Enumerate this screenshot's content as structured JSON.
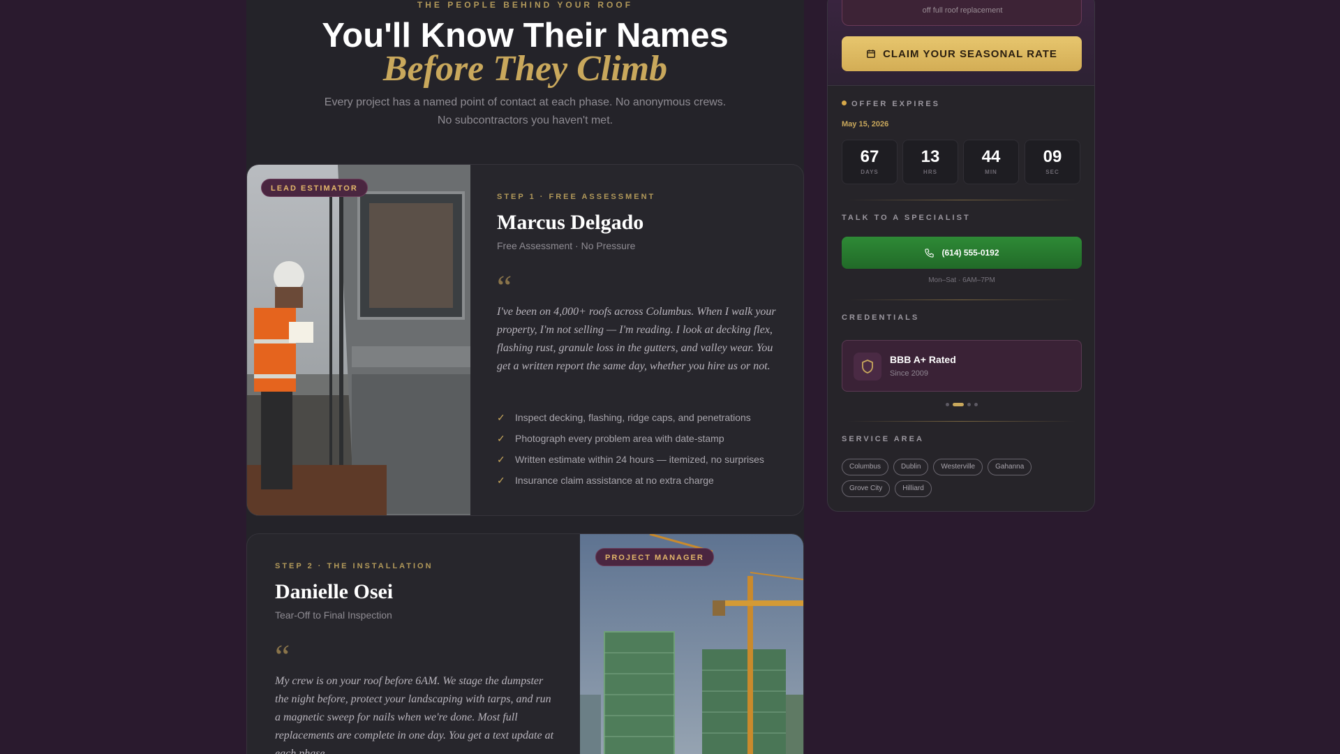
{
  "section": {
    "eyebrow": "THE PEOPLE BEHIND YOUR ROOF",
    "title": "You'll Know Their Names",
    "title_accent": "Before They Climb",
    "intro": "Every project has a named point of contact at each phase. No anonymous crews. No subcontractors you haven't met."
  },
  "team": [
    {
      "badge": "LEAD ESTIMATOR",
      "step": "STEP 1 · FREE ASSESSMENT",
      "name": "Marcus Delgado",
      "subtitle": "Free Assessment · No Pressure",
      "quote": "I've been on 4,000+ roofs across Columbus. When I walk your property, I'm not selling — I'm reading. I look at decking flex, flashing rust, granule loss in the gutters, and valley wear. You get a written report the same day, whether you hire us or not.",
      "checklist": [
        "Inspect decking, flashing, ridge caps, and penetrations",
        "Photograph every problem area with date-stamp",
        "Written estimate within 24 hours — itemized, no surprises",
        "Insurance claim assistance at no extra charge"
      ]
    },
    {
      "badge": "PROJECT MANAGER",
      "step": "STEP 2 · THE INSTALLATION",
      "name": "Danielle Osei",
      "subtitle": "Tear-Off to Final Inspection",
      "quote": "My crew is on your roof before 6AM. We stage the dumpster the night before, protect your landscaping with tarps, and run a magnetic sweep for nails when we're done. Most full replacements are complete in one day. You get a text update at each phase."
    }
  ],
  "sidebar": {
    "promo_sub": "off full roof replacement",
    "claim_label": "CLAIM YOUR SEASONAL RATE",
    "offer_label": "OFFER EXPIRES",
    "offer_date": "May 15, 2026",
    "countdown": [
      {
        "value": "67",
        "unit": "DAYS"
      },
      {
        "value": "13",
        "unit": "HRS"
      },
      {
        "value": "44",
        "unit": "MIN"
      },
      {
        "value": "09",
        "unit": "SEC"
      }
    ],
    "specialist_label": "TALK TO A SPECIALIST",
    "phone": "(614) 555-0192",
    "hours": "Mon–Sat · 6AM–7PM",
    "credentials_label": "CREDENTIALS",
    "credential": {
      "title": "BBB A+ Rated",
      "sub": "Since 2009"
    },
    "credential_slides": 4,
    "credential_active": 2,
    "service_label": "SERVICE AREA",
    "service_areas": [
      "Columbus",
      "Dublin",
      "Westerville",
      "Gahanna",
      "Grove City",
      "Hilliard"
    ]
  },
  "colors": {
    "background": "#2a1a2e",
    "accent_gold": "#c9a85c",
    "cta_green": "#2e8a36",
    "badge_bg": "#4a2640"
  }
}
